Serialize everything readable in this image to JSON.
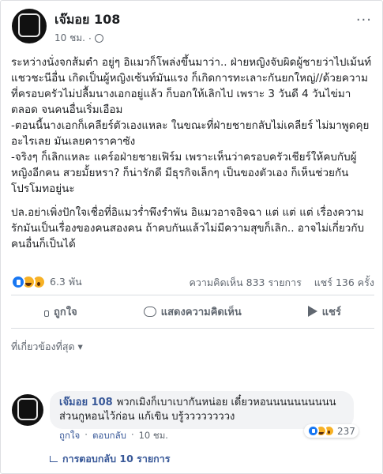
{
  "post": {
    "author": "เจ๊มอย 108",
    "time": "10 ชม.",
    "privacy_icon": "globe-icon",
    "more_label": "···",
    "paragraphs": [
      "ระหว่างนั่งจกส้มตำ อยู่ๆ อิแมวก็โพล่งขึ้นมาว่า.. ฝ่ายหญิงจับผิดผู้ชายว่าไปเม้นท์แชวชะนีอื่น เกิดเป็นผู้หญิงเซ้นท์มันแรง ก็เกิดการทะเลาะกันยกใหญ่//ด้วยความที่ครอบครัวไม่ปลื้มนางเอกอยู่แล้ว ก็บอกให้เลิกไป เพราะ 3 วันดี 4 วันไข่มาตลอด จนคนอื่นเริ่มเอือม",
      "-ตอนนี้นางเอกก็เคลียร์ตัวเองแหละ ในขณะที่ฝ่ายชายกลับไม่เคลียร์ ไม่มาพูดคุยอะไรเลย มันเลยคาราคาซัง",
      "-จริงๆ ก็เลิกแหละ แคร์อฝ่ายชายเฟิร์ม เพราะเห็นว่าครอบครัวเชียร์ให้คบกับผู้หญิงอีกคน สวยมั้ยหรา? ก็น่ารักดี มีธุรกิจเล็กๆ เป็นของตัวเอง ก็เห็นช่วยกันโปรโมทอยู่นะ",
      "ปล.อย่าเพิ่งปักใจเชื่อที่อิแมวร่ำพึงรำพัน อิแมวอาจอิจฉา แต่ แต่ แต่ เรื่องความรักมันเป็นเรื่องของคนสองคน ถ้าคบกันแล้วไม่มีความสุขก็เลิก.. อาจไม่เกี่ยวกับคนอื่นก็เป็นได้"
    ],
    "reaction_count": "6.3 พัน",
    "comments_count": "ความคิดเห็น 833 รายการ",
    "shares_count": "แชร์ 136 ครั้ง",
    "actions": {
      "like": "ถูกใจ",
      "comment": "แสดงความคิดเห็น",
      "share": "แชร์"
    },
    "sort_label": "ที่เกี่ยวข้องที่สุด ▾"
  },
  "comment": {
    "author": "เจ๊มอย 108",
    "text": "พวกเมิงก็เบาเบากันหน่อย เดี๋ยวหอนนนนนนนนนน ส่วนกูหอนไว้ก่อน แก้เขิน บรู้ววววววววง",
    "like": "ถูกใจ",
    "reply": "ตอบกลับ",
    "time": "10 ชม.",
    "reaction_count": "237",
    "replies_label": "การตอบกลับ 10 รายการ"
  },
  "avatar_label": "",
  "colors": {
    "link": "#385898",
    "muted": "#606770",
    "like_blue": "#1877f2",
    "emoji_yellow": "#f7b125"
  }
}
